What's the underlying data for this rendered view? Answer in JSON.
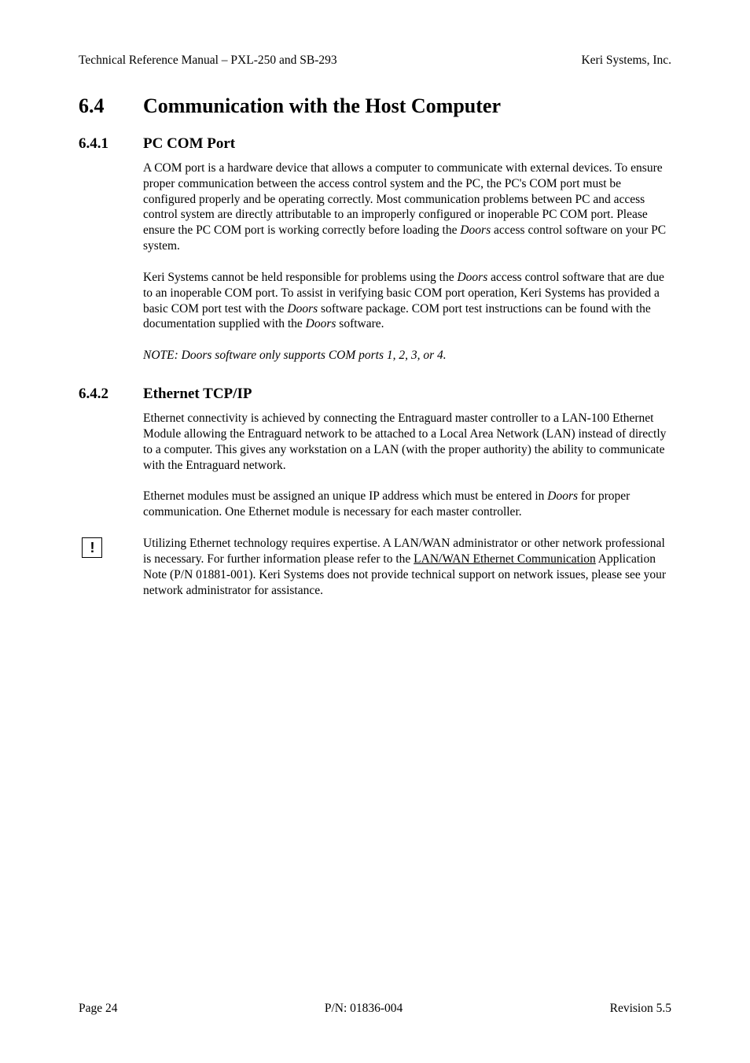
{
  "header": {
    "left": "Technical Reference Manual – PXL-250 and SB-293",
    "right": "Keri Systems, Inc."
  },
  "h1": {
    "num": "6.4",
    "title": "Communication with the Host Computer"
  },
  "s1": {
    "num": "6.4.1",
    "title": "PC COM Port",
    "p1a": "A COM port is a hardware device that allows a computer to communicate with external devices. To ensure proper communication between the access control system and the PC, the PC's COM port must be configured properly and be operating correctly. Most communication problems between PC and access control system are directly attributable to an improperly configured or inoperable PC COM port. Please ensure the PC COM port is working correctly before loading the ",
    "doors": "Doors",
    "p1b": " access control software on your PC system.",
    "p2a": "Keri Systems cannot be held responsible for problems using the ",
    "p2b": " access control software that are due to an inoperable COM port. To assist in verifying basic COM port operation, Keri Systems has provided a basic COM port test with the ",
    "p2c": " software package. COM port test instructions can be found with the documentation supplied with the ",
    "p2d": " software.",
    "note": "NOTE: Doors software only supports COM ports 1, 2, 3, or 4."
  },
  "s2": {
    "num": "6.4.2",
    "title": "Ethernet TCP/IP",
    "p1": "Ethernet connectivity is achieved by connecting the Entraguard master controller to a LAN-100 Ethernet Module allowing the Entraguard network to be attached to a Local Area Network (LAN) instead of directly to a computer. This gives any workstation on a LAN (with the proper authority) the ability to communicate with the Entraguard network.",
    "p2a": "Ethernet modules must be assigned an unique IP address which must be entered in ",
    "p2b": " for proper communication.  One Ethernet module is necessary for each master controller.",
    "alertChar": "!",
    "alertA": "Utilizing Ethernet technology requires expertise.  A LAN/WAN administrator or other network professional is necessary.  For further information please refer to the ",
    "alertLink1": "LAN/",
    "alertLink2": "WAN Ethernet Communication",
    "alertB": " Application Note (P/N 01881-001).  Keri Systems does not provide technical support on network issues, please see your network administrator for assistance."
  },
  "footer": {
    "left": "Page 24",
    "center": "P/N: 01836-004",
    "right": "Revision 5.5"
  }
}
